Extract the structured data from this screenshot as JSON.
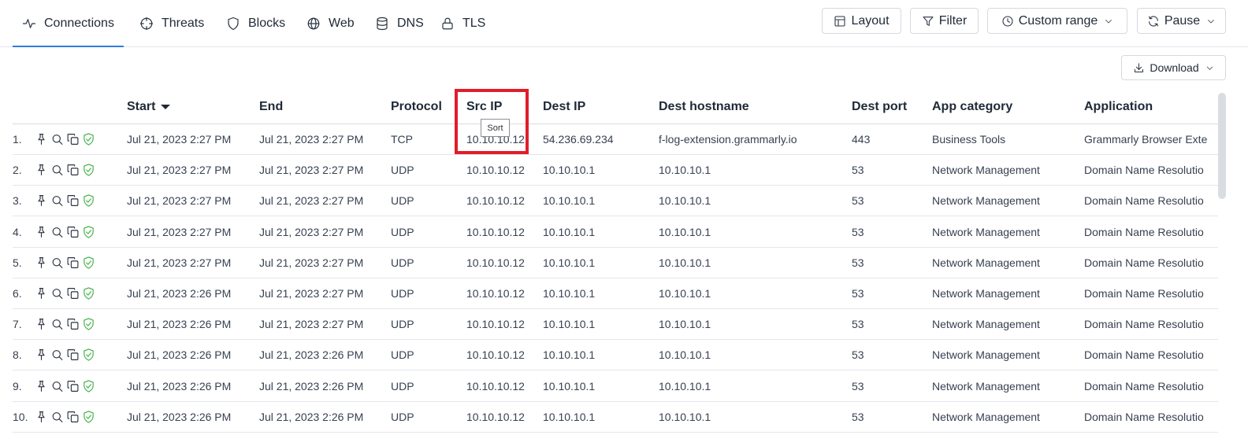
{
  "tabs": [
    {
      "label": "Connections",
      "icon": "activity-icon",
      "active": true
    },
    {
      "label": "Threats",
      "icon": "crosshair-icon"
    },
    {
      "label": "Blocks",
      "icon": "shield-icon"
    },
    {
      "label": "Web",
      "icon": "globe-icon"
    },
    {
      "label": "DNS",
      "icon": "database-icon"
    },
    {
      "label": "TLS",
      "icon": "lock-icon"
    }
  ],
  "toolbar": {
    "layout": "Layout",
    "filter": "Filter",
    "range": "Custom range",
    "pause": "Pause",
    "download": "Download"
  },
  "table": {
    "columns": [
      "Start",
      "End",
      "Protocol",
      "Src IP",
      "Dest IP",
      "Dest hostname",
      "Dest port",
      "App category",
      "Application"
    ],
    "sorted_column": "Start",
    "tooltip": "Sort",
    "rows": [
      {
        "idx": "1.",
        "start": "Jul 21, 2023 2:27 PM",
        "end": "Jul 21, 2023 2:27 PM",
        "protocol": "TCP",
        "src": "10.10.10.12",
        "dst": "54.236.69.234",
        "host": "f-log-extension.grammarly.io",
        "port": "443",
        "category": "Business Tools",
        "app": "Grammarly Browser Exte"
      },
      {
        "idx": "2.",
        "start": "Jul 21, 2023 2:27 PM",
        "end": "Jul 21, 2023 2:27 PM",
        "protocol": "UDP",
        "src": "10.10.10.12",
        "dst": "10.10.10.1",
        "host": "10.10.10.1",
        "port": "53",
        "category": "Network Management",
        "app": "Domain Name Resolutio"
      },
      {
        "idx": "3.",
        "start": "Jul 21, 2023 2:27 PM",
        "end": "Jul 21, 2023 2:27 PM",
        "protocol": "UDP",
        "src": "10.10.10.12",
        "dst": "10.10.10.1",
        "host": "10.10.10.1",
        "port": "53",
        "category": "Network Management",
        "app": "Domain Name Resolutio"
      },
      {
        "idx": "4.",
        "start": "Jul 21, 2023 2:27 PM",
        "end": "Jul 21, 2023 2:27 PM",
        "protocol": "UDP",
        "src": "10.10.10.12",
        "dst": "10.10.10.1",
        "host": "10.10.10.1",
        "port": "53",
        "category": "Network Management",
        "app": "Domain Name Resolutio"
      },
      {
        "idx": "5.",
        "start": "Jul 21, 2023 2:27 PM",
        "end": "Jul 21, 2023 2:27 PM",
        "protocol": "UDP",
        "src": "10.10.10.12",
        "dst": "10.10.10.1",
        "host": "10.10.10.1",
        "port": "53",
        "category": "Network Management",
        "app": "Domain Name Resolutio"
      },
      {
        "idx": "6.",
        "start": "Jul 21, 2023 2:26 PM",
        "end": "Jul 21, 2023 2:27 PM",
        "protocol": "UDP",
        "src": "10.10.10.12",
        "dst": "10.10.10.1",
        "host": "10.10.10.1",
        "port": "53",
        "category": "Network Management",
        "app": "Domain Name Resolutio"
      },
      {
        "idx": "7.",
        "start": "Jul 21, 2023 2:26 PM",
        "end": "Jul 21, 2023 2:27 PM",
        "protocol": "UDP",
        "src": "10.10.10.12",
        "dst": "10.10.10.1",
        "host": "10.10.10.1",
        "port": "53",
        "category": "Network Management",
        "app": "Domain Name Resolutio"
      },
      {
        "idx": "8.",
        "start": "Jul 21, 2023 2:26 PM",
        "end": "Jul 21, 2023 2:26 PM",
        "protocol": "UDP",
        "src": "10.10.10.12",
        "dst": "10.10.10.1",
        "host": "10.10.10.1",
        "port": "53",
        "category": "Network Management",
        "app": "Domain Name Resolutio"
      },
      {
        "idx": "9.",
        "start": "Jul 21, 2023 2:26 PM",
        "end": "Jul 21, 2023 2:26 PM",
        "protocol": "UDP",
        "src": "10.10.10.12",
        "dst": "10.10.10.1",
        "host": "10.10.10.1",
        "port": "53",
        "category": "Network Management",
        "app": "Domain Name Resolutio"
      },
      {
        "idx": "10.",
        "start": "Jul 21, 2023 2:26 PM",
        "end": "Jul 21, 2023 2:26 PM",
        "protocol": "UDP",
        "src": "10.10.10.12",
        "dst": "10.10.10.1",
        "host": "10.10.10.1",
        "port": "53",
        "category": "Network Management",
        "app": "Domain Name Resolutio"
      }
    ]
  },
  "colors": {
    "accent": "#2f7fd8",
    "highlight": "#e11d2a",
    "shield": "#3cb043"
  }
}
